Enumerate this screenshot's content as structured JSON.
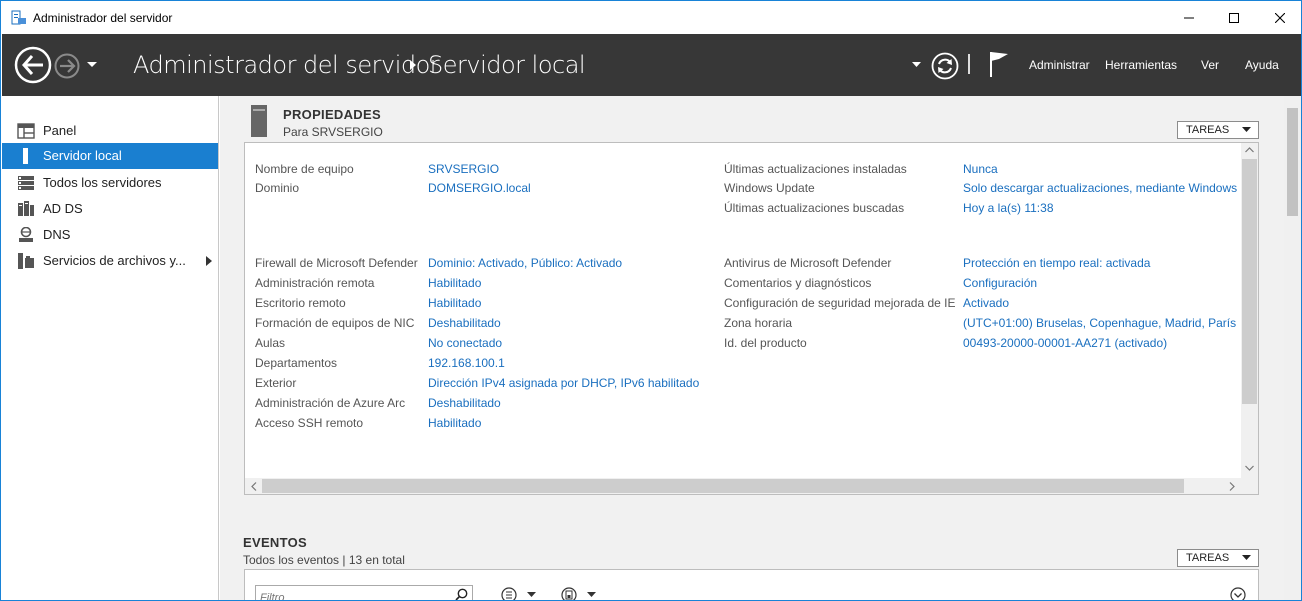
{
  "window": {
    "title": "Administrador del servidor"
  },
  "header": {
    "breadcrumb_root": "Administrador del servidor",
    "breadcrumb_current": "Servidor local",
    "menu": [
      "Administrar",
      "Herramientas",
      "Ver",
      "Ayuda"
    ]
  },
  "sidebar": {
    "items": [
      {
        "label": "Panel",
        "icon": "dashboard-icon"
      },
      {
        "label": "Servidor local",
        "icon": "server-icon",
        "active": true
      },
      {
        "label": "Todos los servidores",
        "icon": "servers-icon"
      },
      {
        "label": "AD DS",
        "icon": "ad-ds-icon"
      },
      {
        "label": "DNS",
        "icon": "dns-icon"
      },
      {
        "label": "Servicios de archivos y...",
        "icon": "file-services-icon",
        "has_submenu": true
      }
    ]
  },
  "properties": {
    "title": "PROPIEDADES",
    "subtitle": "Para SRVSERGIO",
    "tasks_label": "TAREAS",
    "left_col": [
      {
        "label": "Nombre de equipo",
        "value": "SRVSERGIO"
      },
      {
        "label": "Dominio",
        "value": "DOMSERGIO.local"
      },
      {
        "label": "Firewall de Microsoft Defender",
        "value": "Dominio: Activado, Público: Activado"
      },
      {
        "label": "Administración remota",
        "value": "Habilitado"
      },
      {
        "label": "Escritorio remoto",
        "value": "Habilitado"
      },
      {
        "label": "Formación de equipos de NIC",
        "value": "Deshabilitado"
      },
      {
        "label": "Aulas",
        "value": "No conectado"
      },
      {
        "label": "Departamentos",
        "value": "192.168.100.1"
      },
      {
        "label": "Exterior",
        "value": "Dirección IPv4 asignada por DHCP, IPv6 habilitado"
      },
      {
        "label": "Administración de Azure Arc",
        "value": "Deshabilitado"
      },
      {
        "label": "Acceso SSH remoto",
        "value": "Habilitado"
      }
    ],
    "right_col": [
      {
        "label": "Últimas actualizaciones instaladas",
        "value": "Nunca"
      },
      {
        "label": "Windows Update",
        "value": "Solo descargar actualizaciones, mediante Windows Update"
      },
      {
        "label": "Últimas actualizaciones buscadas",
        "value": "Hoy a la(s) 11:38"
      },
      {
        "label": "Antivirus de Microsoft Defender",
        "value": "Protección en tiempo real: activada"
      },
      {
        "label": "Comentarios y diagnósticos",
        "value": "Configuración"
      },
      {
        "label": "Configuración de seguridad mejorada de IE",
        "value": "Activado"
      },
      {
        "label": "Zona horaria",
        "value": "(UTC+01:00) Bruselas, Copenhague, Madrid, París"
      },
      {
        "label": "Id. del producto",
        "value": "00493-20000-00001-AA271 (activado)"
      }
    ]
  },
  "events": {
    "title": "EVENTOS",
    "subtitle": "Todos los eventos | 13 en total",
    "tasks_label": "TAREAS",
    "filter_placeholder": "Filtro"
  }
}
